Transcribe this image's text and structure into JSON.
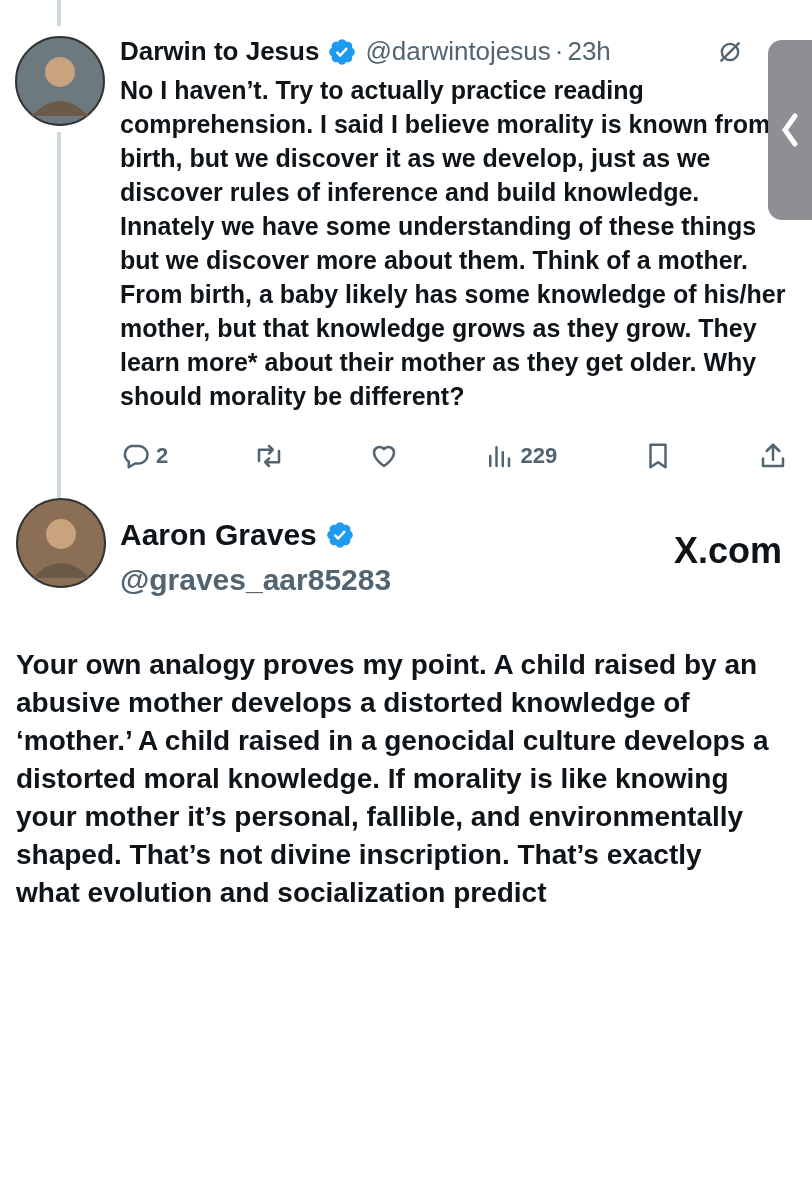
{
  "reply_tweet": {
    "author": {
      "name": "Darwin to Jesus",
      "verified": true,
      "handle": "@darwintojesus",
      "separator": "·",
      "time": "23h"
    },
    "body": "No I haven’t. Try to actually practice reading comprehension. I said I believe morality is known from birth, but we discover it as we develop, just as we discover rules of inference and build knowledge. Innately we have some understanding of these things but we discover more about them. Think of a mother. From birth, a baby likely has some knowledge of his/her mother, but that knowledge grows as they grow. They learn more* about their mother as they get older. Why should morality be different?",
    "actions": [
      {
        "kind": "reply",
        "count": "2"
      },
      {
        "kind": "repost"
      },
      {
        "kind": "like"
      },
      {
        "kind": "views",
        "count": "229"
      },
      {
        "kind": "bookmark"
      },
      {
        "kind": "share"
      }
    ]
  },
  "main_tweet": {
    "author": {
      "name": "Aaron Graves",
      "verified": true,
      "handle": "@graves_aar85283"
    },
    "source": "X.com",
    "body": "Your own analogy proves my point. A child raised by an abusive mother develops a distorted knowledge of ‘mother.’ A child raised in a genocidal culture develops a distorted moral knowledge. If morality is like knowing your mother it’s personal, fallible, and environmentally shaped. That’s not divine inscription. That’s exactly what evolution and socialization predict"
  }
}
